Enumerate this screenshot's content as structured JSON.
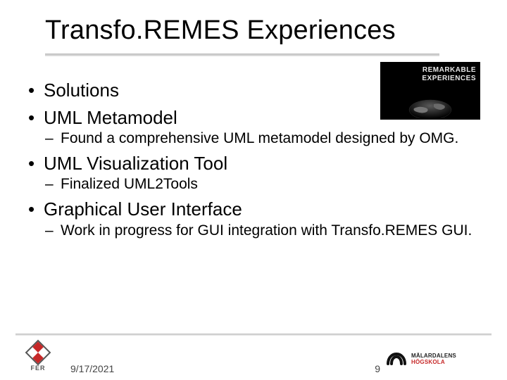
{
  "title": "Transfo.REMES Experiences",
  "badge": {
    "line1": "REMARKABLE",
    "line2": "EXPERIENCES"
  },
  "bullets": [
    {
      "text": "Solutions",
      "children": []
    },
    {
      "text": "UML Metamodel",
      "children": [
        {
          "text": "Found a comprehensive UML metamodel designed by OMG."
        }
      ]
    },
    {
      "text": "UML Visualization  Tool",
      "children": [
        {
          "text": "Finalized UML2Tools"
        }
      ]
    },
    {
      "text": "Graphical User Interface",
      "children": [
        {
          "text": "Work in progress for GUI integration with Transfo.REMES GUI."
        }
      ]
    }
  ],
  "footer": {
    "date": "9/17/2021",
    "page": "9",
    "fer_label": "FER",
    "mdh_label1": "MÄLARDALENS",
    "mdh_label2": "HÖGSKOLA"
  }
}
